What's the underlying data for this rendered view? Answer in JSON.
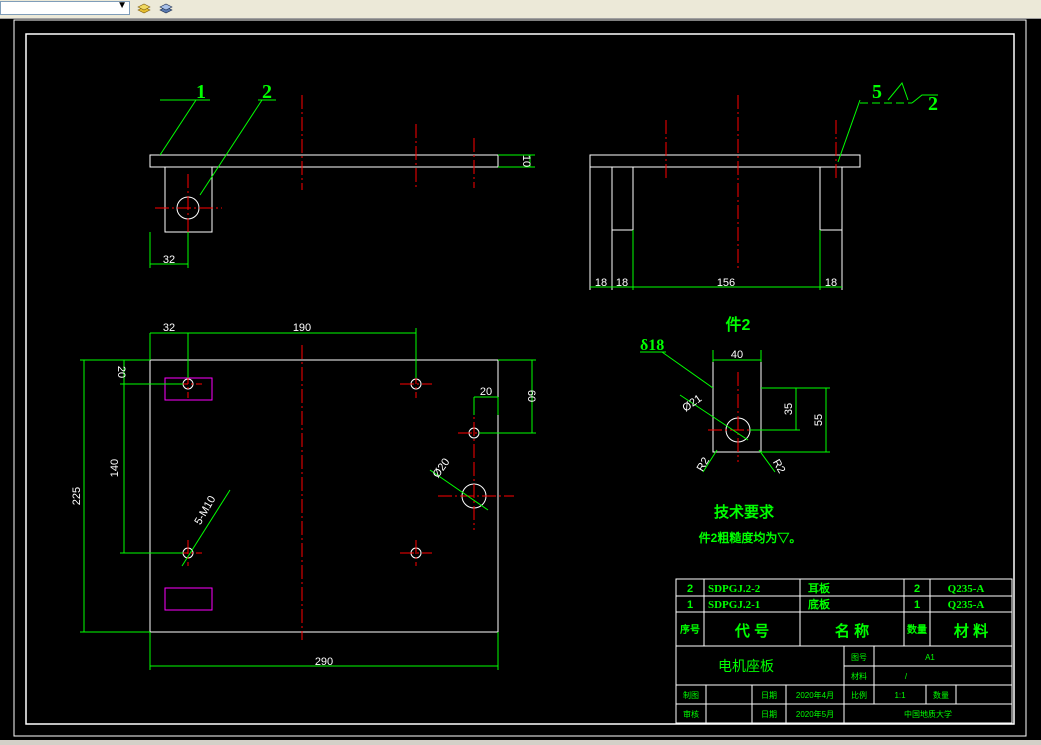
{
  "toolbar": {
    "layer_value": "",
    "icons": [
      "layer-states-icon",
      "layer-properties-icon"
    ]
  },
  "colors": {
    "background": "#000000",
    "outline": "#ffffff",
    "center_line": "#ff0000",
    "dimension": "#00ff00",
    "rect_mark": "#ff00ff"
  },
  "drawing": {
    "front_view": {
      "leader_1": "1",
      "leader_2": "2",
      "dim_thickness": "10",
      "dim_width": "32"
    },
    "side_view": {
      "surface_num": "5",
      "surface_ref": "2",
      "dims": [
        "18",
        "18",
        "156",
        "18"
      ]
    },
    "top_view": {
      "dim_32": "32",
      "dim_190": "190",
      "dim_20_left": "20",
      "dim_140": "140",
      "dim_225": "225",
      "dim_20_right": "20",
      "dim_60": "60",
      "dim_hole": "Ø20",
      "dim_thread": "5-M10",
      "dim_290": "290"
    },
    "part2": {
      "title": "件2",
      "thickness": "δ18",
      "dim_40": "40",
      "dim_hole": "Ø21",
      "dim_35": "35",
      "dim_55": "55",
      "dim_r_left": "R2",
      "dim_r_right": "R2"
    },
    "tech": {
      "title": "技术要求",
      "note": "件2粗糙度均为▽。"
    }
  },
  "title_block": {
    "parts": [
      {
        "no": "2",
        "code": "SDPGJ.2-2",
        "name": "耳板",
        "qty": "2",
        "material": "Q235-A"
      },
      {
        "no": "1",
        "code": "SDPGJ.2-1",
        "name": "底板",
        "qty": "1",
        "material": "Q235-A"
      }
    ],
    "headers": {
      "no": "序号",
      "code": "代 号",
      "name": "名 称",
      "qty": "数量",
      "material": "材 料"
    },
    "drawing_name": "电机座板",
    "labels": {
      "sheet": "图号",
      "material": "材料",
      "drawn": "制图",
      "date1": "日期",
      "scale": "比例",
      "quantity": "数量",
      "review": "审核",
      "date2": "日期"
    },
    "values": {
      "sheet": "A1",
      "material": "/",
      "date1": "2020年4月",
      "scale": "1:1",
      "date2": "2020年5月",
      "school": "中国地质大学"
    }
  }
}
